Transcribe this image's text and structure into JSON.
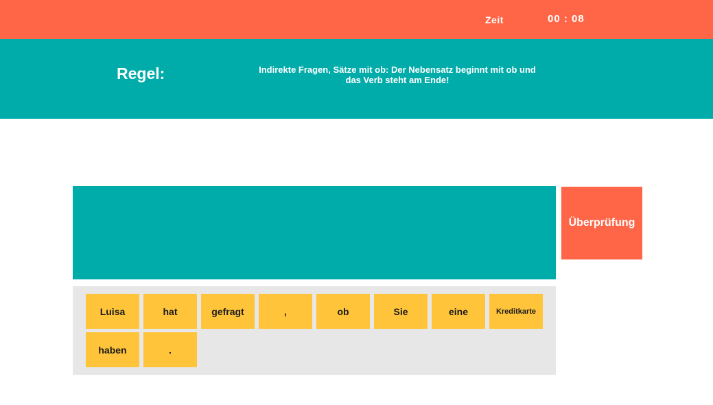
{
  "header": {
    "timer_label": "Zeit",
    "timer_value": "00 : 08"
  },
  "rule": {
    "title": "Regel:",
    "line1": "Indirekte Fragen, Sätze mit ob: Der Nebensatz beginnt mit ob und",
    "line2": "das Verb steht am Ende!"
  },
  "check_button": {
    "label": "Überprüfung"
  },
  "word_bank": {
    "tiles": [
      "Luisa",
      "hat",
      "gefragt",
      ",",
      "ob",
      "Sie",
      "eine",
      "Kreditkarte",
      "haben",
      "."
    ]
  },
  "colors": {
    "top_bar": "#ff6547",
    "rule_bar": "#00aca9",
    "answer_area": "#00aca9",
    "check_button": "#ff6547",
    "word_bank": "#e7e7e7",
    "word_tile": "#ffc43a"
  }
}
